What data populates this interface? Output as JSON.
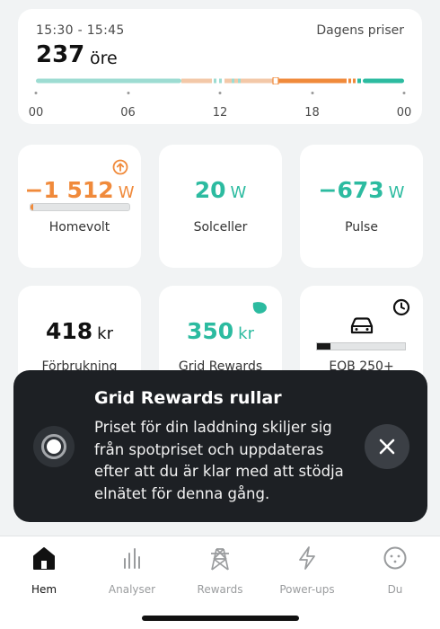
{
  "price": {
    "time_range": "15:30 - 15:45",
    "header_label": "Dagens priser",
    "value": "237",
    "unit": "öre",
    "ticks": [
      "00",
      "06",
      "12",
      "18",
      "00"
    ],
    "current_hour_fraction": 0.65,
    "segment_colors": {
      "low": "#9ddcd2",
      "mid": "#f3c8a8",
      "high": "#f08a3b",
      "green": "#2cbba0"
    }
  },
  "cards": {
    "homevolt": {
      "value": "−1 512",
      "unit": "W",
      "name": "Homevolt",
      "battery_level": 0.02
    },
    "solceller": {
      "value": "20",
      "unit": "W",
      "name": "Solceller"
    },
    "pulse": {
      "value": "−673",
      "unit": "W",
      "name": "Pulse"
    },
    "forbrukning": {
      "value": "418",
      "unit": "kr",
      "name": "Förbrukning"
    },
    "grid_rewards": {
      "value": "350",
      "unit": "kr",
      "name": "Grid Rewards"
    },
    "eqb": {
      "name": "EQB 250+",
      "charge_level": 0.15
    }
  },
  "toast": {
    "title": "Grid Rewards rullar",
    "body": "Priset för din laddning skiljer sig från spotpriset och uppdateras efter att du är klar med att stödja elnätet för denna gång."
  },
  "nav": {
    "items": [
      {
        "label": "Hem",
        "icon": "home-icon",
        "active": true
      },
      {
        "label": "Analyser",
        "icon": "bar-chart-icon",
        "active": false
      },
      {
        "label": "Rewards",
        "icon": "power-tower-icon",
        "active": false
      },
      {
        "label": "Power-ups",
        "icon": "lightning-icon",
        "active": false
      },
      {
        "label": "Du",
        "icon": "face-icon",
        "active": false
      }
    ]
  },
  "colors": {
    "orange": "#f08a3b",
    "teal": "#2cbba0",
    "toast_bg": "#1d2024"
  }
}
